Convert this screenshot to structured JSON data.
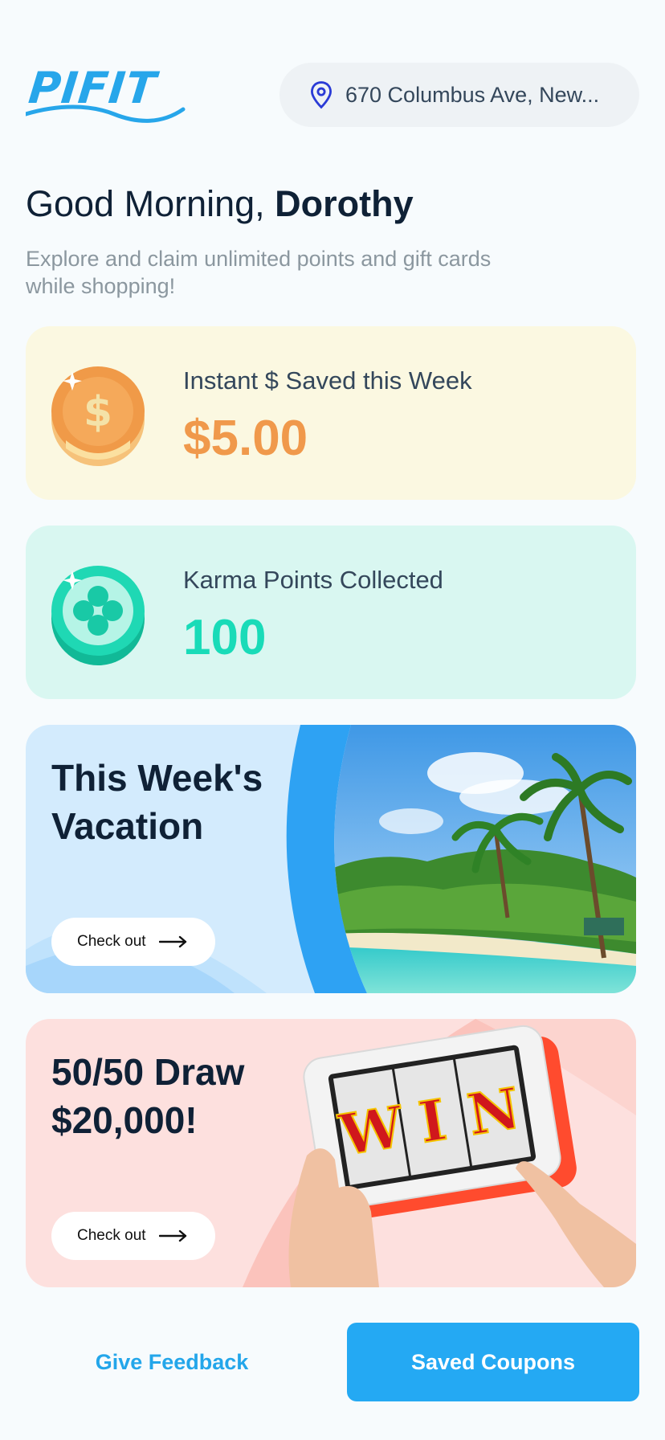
{
  "app": {
    "logo_text": "PIFIT"
  },
  "location": {
    "address": "670 Columbus Ave, New...",
    "icon": "map-pin-icon"
  },
  "greeting": {
    "prefix": "Good Morning, ",
    "name": "Dorothy"
  },
  "subtitle": "Explore and claim unlimited points and gift cards while shopping!",
  "stats": {
    "savings": {
      "label": "Instant $ Saved this Week",
      "value": "$5.00",
      "icon": "dollar-coin-icon",
      "color": "#f0994b"
    },
    "karma": {
      "label": "Karma Points Collected",
      "value": "100",
      "icon": "clover-coin-icon",
      "color": "#19dbb8"
    }
  },
  "promos": {
    "vacation": {
      "title": "This Week's Vacation",
      "cta": "Check out",
      "image": "tropical-beach-image"
    },
    "draw": {
      "title": "50/50 Draw $20,000!",
      "cta": "Check out",
      "image": "slot-machine-tablet-image",
      "slot_letters": [
        "W",
        "I",
        "N"
      ]
    }
  },
  "actions": {
    "feedback": "Give Feedback",
    "saved": "Saved Coupons"
  },
  "colors": {
    "brand": "#27a6ea",
    "primary_button": "#24a9f3",
    "savings_bg": "#fbf8e1",
    "karma_bg": "#d9f7f1",
    "vacation_bg": "#d3ebfd",
    "draw_bg": "#fde0de"
  }
}
